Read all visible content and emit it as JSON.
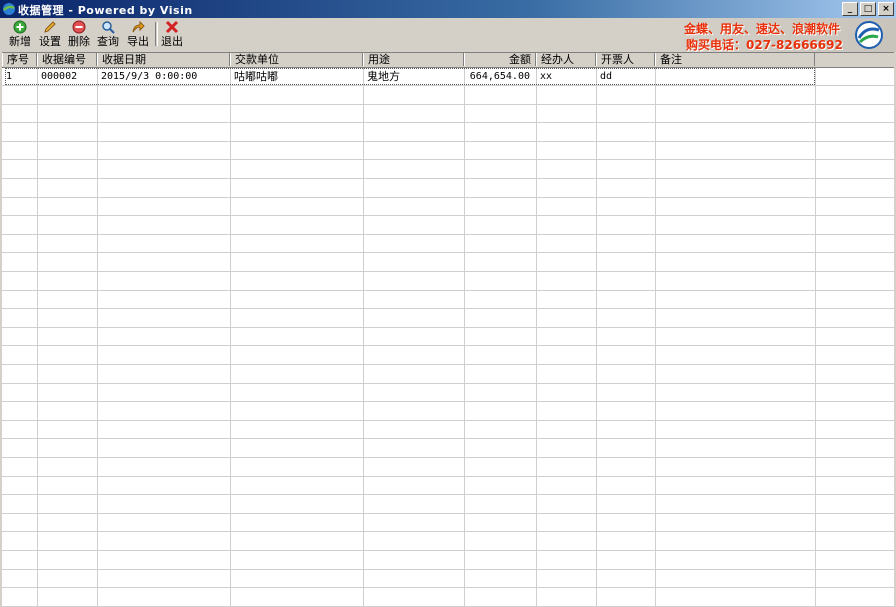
{
  "window": {
    "title": "收据管理 - Powered by Visin",
    "app_icon": "app-icon",
    "controls": {
      "minimize": "_",
      "maximize": "□",
      "close": "×"
    }
  },
  "toolbar": {
    "buttons": [
      {
        "label": "新增",
        "icon": "add-icon"
      },
      {
        "label": "设置",
        "icon": "edit-icon"
      },
      {
        "label": "删除",
        "icon": "delete-icon"
      },
      {
        "label": "查询",
        "icon": "search-icon"
      },
      {
        "label": "导出",
        "icon": "export-icon"
      },
      {
        "label": "退出",
        "icon": "exit-icon"
      }
    ]
  },
  "banner": {
    "line1": "金蝶、用友、速达、浪潮软件",
    "line2": "购买电话：027-82666692",
    "color": "#e8300a"
  },
  "table": {
    "columns": [
      "序号",
      "收据编号",
      "收据日期",
      "交款单位",
      "用途",
      "金额",
      "经办人",
      "开票人",
      "备注"
    ],
    "rows": [
      [
        "1",
        "000002",
        "2015/9/3 0:00:00",
        "咕嘟咕嘟",
        "鬼地方",
        "664,654.00",
        "xx",
        "dd",
        ""
      ]
    ]
  }
}
